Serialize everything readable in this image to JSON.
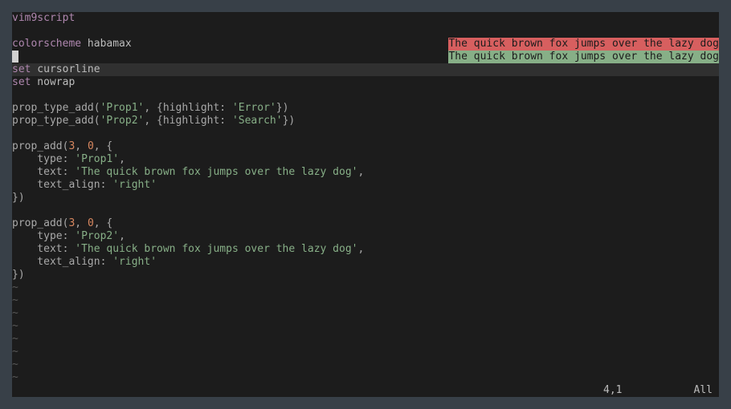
{
  "editor": {
    "lines": [
      {
        "t": "kw",
        "a": "vim9script"
      },
      {
        "t": "blank"
      },
      {
        "t": "cs",
        "a": "colorscheme",
        "b": " habamax"
      },
      {
        "t": "cursor"
      },
      {
        "t": "set",
        "a": "set",
        "b": " cursorline"
      },
      {
        "t": "set",
        "a": "set",
        "b": " nowrap"
      },
      {
        "t": "blank"
      },
      {
        "t": "pta",
        "a": "prop_type_add(",
        "s1": "'Prop1'",
        "m": ", {highlight: ",
        "s2": "'Error'",
        "e": "})"
      },
      {
        "t": "pta",
        "a": "prop_type_add(",
        "s1": "'Prop2'",
        "m": ", {highlight: ",
        "s2": "'Search'",
        "e": "})"
      },
      {
        "t": "blank"
      },
      {
        "t": "pa",
        "a": "prop_add(",
        "n1": "3",
        "m": ", ",
        "n2": "0",
        "e": ", {"
      },
      {
        "t": "kv",
        "k": "    type: ",
        "v": "'Prop1'",
        "e": ","
      },
      {
        "t": "kv",
        "k": "    text: ",
        "v": "'The quick brown fox jumps over the lazy dog'",
        "e": ","
      },
      {
        "t": "kv",
        "k": "    text_align: ",
        "v": "'right'",
        "e": ""
      },
      {
        "t": "plain",
        "a": "})"
      },
      {
        "t": "blank"
      },
      {
        "t": "pa",
        "a": "prop_add(",
        "n1": "3",
        "m": ", ",
        "n2": "0",
        "e": ", {"
      },
      {
        "t": "kv",
        "k": "    type: ",
        "v": "'Prop2'",
        "e": ","
      },
      {
        "t": "kv",
        "k": "    text: ",
        "v": "'The quick brown fox jumps over the lazy dog'",
        "e": ","
      },
      {
        "t": "kv",
        "k": "    text_align: ",
        "v": "'right'",
        "e": ""
      },
      {
        "t": "plain",
        "a": "})"
      }
    ],
    "tilde_count": 8,
    "tilde_char": "~",
    "virtual_text": {
      "error": "The quick brown fox jumps over the lazy dog",
      "search": "The quick brown fox jumps over the lazy dog"
    },
    "cursorline_index": 4
  },
  "statusline": {
    "position": "4,1",
    "percent": "All"
  },
  "colors": {
    "background": "#1c1c1c",
    "frame": "#384048",
    "keyword": "#af87af",
    "string": "#87af87",
    "number": "#d7875f",
    "error_bg": "#d75f5f",
    "search_bg": "#87af87"
  }
}
